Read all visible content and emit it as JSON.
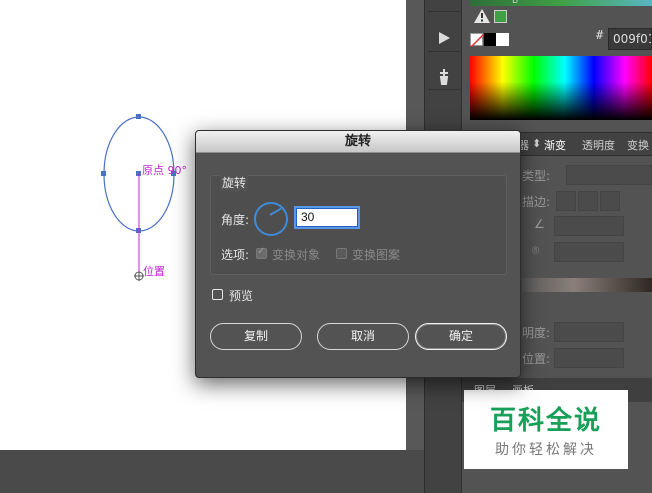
{
  "canvas": {
    "origin_label": "原点 90°",
    "position_label": "位置",
    "shape_color": "#4a72c4",
    "marker_color": "#c026d3"
  },
  "toolbar": {
    "tools": [
      "warning-icon",
      "play-icon",
      "puppet-warp-icon"
    ]
  },
  "color_panel": {
    "channel_label": "B",
    "hex_prefix": "#",
    "hex_value": "009f01",
    "fill_color": "#3fa045"
  },
  "gradient_panel": {
    "tabs": [
      "器",
      "渐变",
      "透明度",
      "变换"
    ],
    "active_tab": "渐变",
    "type_label": "类型:",
    "stroke_label": "描边:",
    "opacity_label": "明度:",
    "location_label": "位置:"
  },
  "layers_tabs": [
    "图层",
    "画板"
  ],
  "dialog": {
    "title": "旋转",
    "group_title": "旋转",
    "angle_label": "角度:",
    "angle_value": "30",
    "options_label": "选项:",
    "transform_objects_label": "变换对象",
    "transform_objects_checked": true,
    "transform_patterns_label": "变换图案",
    "transform_patterns_checked": false,
    "preview_label": "预览",
    "preview_checked": false,
    "buttons": {
      "copy": "复制",
      "cancel": "取消",
      "ok": "确定"
    },
    "accent_color": "#3f8bd8"
  },
  "watermark": {
    "main": "百科全说",
    "sub": "助你轻松解决"
  }
}
